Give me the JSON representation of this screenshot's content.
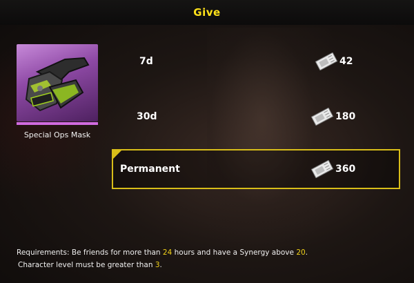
{
  "header": {
    "title": "Give"
  },
  "item": {
    "name": "Special Ops Mask",
    "icon": "tactical-mask-icon",
    "rarity_color": "#d06be0"
  },
  "options": [
    {
      "duration": "7d",
      "price": "42",
      "selected": false
    },
    {
      "duration": "30d",
      "price": "180",
      "selected": false
    },
    {
      "duration": "Permanent",
      "price": "360",
      "selected": true
    }
  ],
  "currency_icon": "voucher-ticket-icon",
  "requirements": {
    "line1_a": "Requirements: Be friends for more than ",
    "hours": "24",
    "line1_b": " hours and have a Synergy above ",
    "synergy": "20",
    "line1_c": ".",
    "line2_a": "Character level must be greater than ",
    "level": "3",
    "line2_b": "."
  },
  "colors": {
    "accent": "#ffe21a",
    "selected_border": "#d9be19",
    "highlight": "#f2d21a"
  }
}
